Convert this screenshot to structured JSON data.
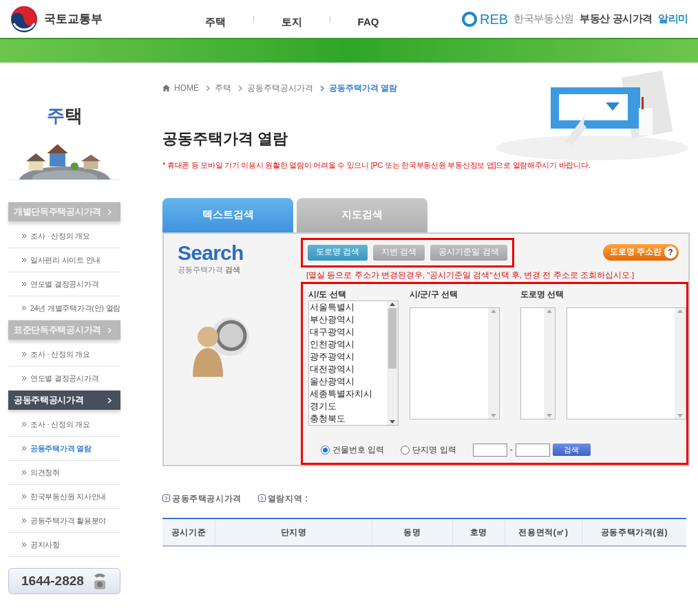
{
  "header": {
    "ministry": "국토교통부",
    "nav": [
      {
        "label": "주택"
      },
      {
        "label": "토지"
      },
      {
        "label": "FAQ"
      }
    ],
    "brand": {
      "mark": "REB",
      "org": "한국부동산원",
      "service": "부동산 공시가격",
      "highlight": "알리미"
    }
  },
  "sidebar": {
    "title": "주택",
    "sections": [
      {
        "label": "개별단독주택공시가격",
        "active": false,
        "items": [
          {
            "label": "조사 · 산정의 개요",
            "selected": false
          },
          {
            "label": "일사편리 사이트 안내",
            "selected": false
          },
          {
            "label": "연도별 결정공시가격",
            "selected": false
          },
          {
            "label": "24년 개별주택가격(안) 열람",
            "selected": false
          }
        ]
      },
      {
        "label": "표준단독주택공시가격",
        "active": false,
        "items": [
          {
            "label": "조사 · 산정의 개요",
            "selected": false
          },
          {
            "label": "연도별 결정공시가격",
            "selected": false
          }
        ]
      },
      {
        "label": "공동주택공시가격",
        "active": true,
        "items": [
          {
            "label": "조사 · 산정의 개요",
            "selected": false
          },
          {
            "label": "공동주택가격 열람",
            "selected": true
          },
          {
            "label": "의견청취",
            "selected": false
          },
          {
            "label": "한국부동산원 지사안내",
            "selected": false
          },
          {
            "label": "공동주택가격 활용분야",
            "selected": false
          },
          {
            "label": "공지사항",
            "selected": false
          }
        ]
      }
    ],
    "phone": "1644-2828"
  },
  "breadcrumb": [
    {
      "label": "HOME",
      "selected": false
    },
    {
      "label": "주택",
      "selected": false
    },
    {
      "label": "공동주택공시가격",
      "selected": false
    },
    {
      "label": "공동주택가격 열람",
      "selected": true
    }
  ],
  "page_title": "공동주택가격 열람",
  "notice": "* 휴대폰 등 모바일 기기 이용시 원활한 열람이 어려울 수 있으니 [PC 또는 한국부동산원 부동산정보 앱]으로 열람해주시기 바랍니다.",
  "tabs": [
    {
      "label": "텍스트검색",
      "selected": true
    },
    {
      "label": "지도검색",
      "selected": false
    }
  ],
  "search": {
    "logo": "Search",
    "subtitle": "공동주택가격 **검색**",
    "modes": [
      {
        "label": "도로명 검색",
        "selected": true
      },
      {
        "label": "지번 검색",
        "selected": false
      },
      {
        "label": "공시기준일 검색",
        "selected": false
      }
    ],
    "help_button": "도로명 주소란",
    "help_icon": "?",
    "warning": "[멸실 등으로 주소가 변경된경우, \"공시기준일 검색\"선택 후, 변경 전 주소로 조회하십시오.]",
    "sido": {
      "label": "시/도 선택",
      "options": [
        "서울특별시",
        "부산광역시",
        "대구광역시",
        "인천광역시",
        "광주광역시",
        "대전광역시",
        "울산광역시",
        "세종특별자치시",
        "경기도",
        "충청북도"
      ]
    },
    "sigungu": {
      "label": "시/군/구 선택"
    },
    "road": {
      "label": "도로명 선택"
    },
    "input_modes": [
      {
        "label": "건물번호 입력",
        "selected": true
      },
      {
        "label": "단지명 입력",
        "selected": false
      }
    ],
    "separator": "-",
    "submit": "검색"
  },
  "results": {
    "labels": [
      "공동주택공시가격",
      "열람지역 :"
    ],
    "columns": [
      "공시기준",
      "단지명",
      "동명",
      "호명",
      "전용면적(㎡)",
      "공동주택가격(원)"
    ]
  }
}
